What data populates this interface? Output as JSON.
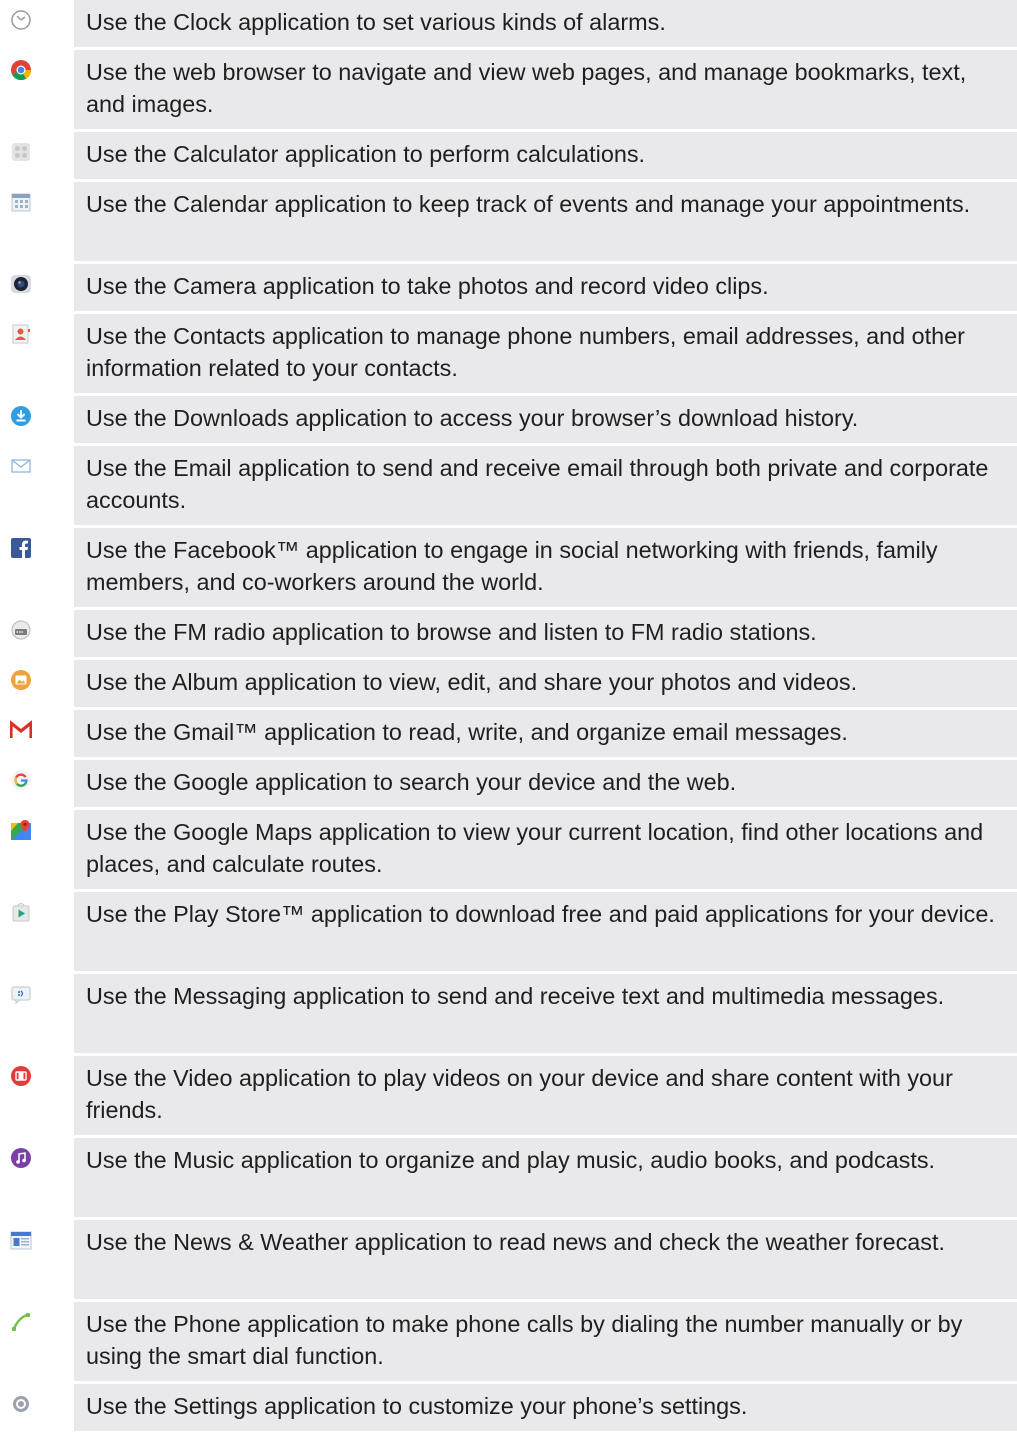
{
  "items": [
    {
      "icon": "clock-icon",
      "text": "Use the Clock application to set various kinds of alarms."
    },
    {
      "icon": "chrome-icon",
      "text": "Use the web browser to navigate and view web pages, and manage bookmarks, text, and images."
    },
    {
      "icon": "calculator-icon",
      "text": "Use the Calculator application to perform calculations."
    },
    {
      "icon": "calendar-icon",
      "text": "Use the Calendar application to keep track of events and manage your appointments."
    },
    {
      "icon": "camera-icon",
      "text": "Use the Camera application to take photos and record video clips."
    },
    {
      "icon": "contacts-icon",
      "text": "Use the Contacts application to manage phone numbers, email addresses, and other information related to your contacts."
    },
    {
      "icon": "downloads-icon",
      "text": "Use the Downloads application to access your browser’s download history."
    },
    {
      "icon": "email-icon",
      "text": "Use the Email application to send and receive email through both private and corporate accounts."
    },
    {
      "icon": "facebook-icon",
      "text": "Use the Facebook™ application to engage in social networking with friends, family members, and co-workers around the world."
    },
    {
      "icon": "fm-radio-icon",
      "text": "Use the FM radio application to browse and listen to FM radio stations."
    },
    {
      "icon": "album-icon",
      "text": "Use the Album application to view, edit, and share your photos and videos."
    },
    {
      "icon": "gmail-icon",
      "text": "Use the Gmail™ application to read, write, and organize email messages."
    },
    {
      "icon": "google-icon",
      "text": "Use the Google application to search your device and the web."
    },
    {
      "icon": "google-maps-icon",
      "text": "Use the Google Maps application to view your current location, find other locations and places, and calculate routes."
    },
    {
      "icon": "play-store-icon",
      "text": "Use the Play Store™ application to download free and paid applications for your device."
    },
    {
      "icon": "messaging-icon",
      "text": "Use the Messaging application to send and receive text and multimedia messages."
    },
    {
      "icon": "video-icon",
      "text": "Use the Video application to play videos on your device and share content with your friends."
    },
    {
      "icon": "music-icon",
      "text": "Use the Music application to organize and play music, audio books, and podcasts."
    },
    {
      "icon": "news-weather-icon",
      "text": "Use the News & Weather application to read news and check the weather forecast."
    },
    {
      "icon": "phone-icon",
      "text": "Use the Phone application to make phone calls by dialing the number manually or by using the smart dial function."
    },
    {
      "icon": "settings-icon",
      "text": "Use the Settings application to customize your phone’s settings."
    }
  ]
}
